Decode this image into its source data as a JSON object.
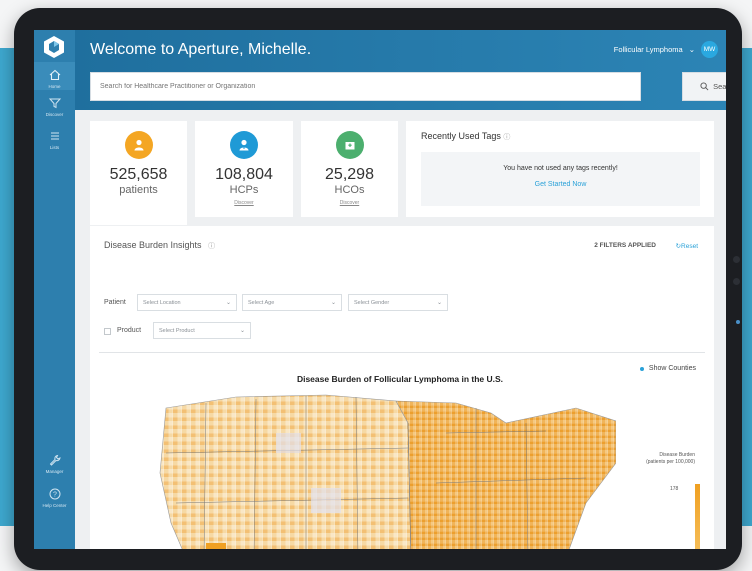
{
  "header": {
    "welcome": "Welcome to Aperture, Michelle.",
    "indication": "Follicular Lymphoma",
    "avatar_initials": "MW"
  },
  "search": {
    "placeholder": "Search for Healthcare Practitioner or Organization",
    "button_label": "Search"
  },
  "sidebar": {
    "items": [
      {
        "label": "Home",
        "icon": "home-icon"
      },
      {
        "label": "Discover",
        "icon": "filter-icon"
      },
      {
        "label": "Lists",
        "icon": "list-icon"
      },
      {
        "label": "Manager",
        "icon": "wrench-icon"
      },
      {
        "label": "Help Center",
        "icon": "help-icon"
      }
    ]
  },
  "stats": [
    {
      "value": "525,658",
      "label": "patients",
      "link": "",
      "color": "#f4a623",
      "icon": "patient-icon"
    },
    {
      "value": "108,804",
      "label": "HCPs",
      "link": "Discover",
      "color": "#1f9ad6",
      "icon": "doctor-icon"
    },
    {
      "value": "25,298",
      "label": "HCOs",
      "link": "Discover",
      "color": "#4caf6e",
      "icon": "hospital-icon"
    }
  ],
  "tags": {
    "title": "Recently Used Tags",
    "message": "You have not used any tags recently!",
    "link": "Get Started Now"
  },
  "insights": {
    "title": "Disease Burden Insights",
    "filters_applied": "2 FILTERS APPLIED",
    "reset": "Reset",
    "patient_label": "Patient",
    "product_label": "Product",
    "select_location": "Select Location",
    "select_age": "Select Age",
    "select_gender": "Select Gender",
    "select_product": "Select Product",
    "show_counties": "Show Counties",
    "map_title": "Disease Burden of Follicular Lymphoma in the U.S.",
    "legend_title": "Disease Burden (patients per 100,000)",
    "legend_max": "178"
  },
  "colors": {
    "accent": "#2aa1d8",
    "header": "#1f6f9e",
    "sidebar": "#2d7fae",
    "map_high": "#f0a022",
    "map_low": "#faf0d9"
  }
}
